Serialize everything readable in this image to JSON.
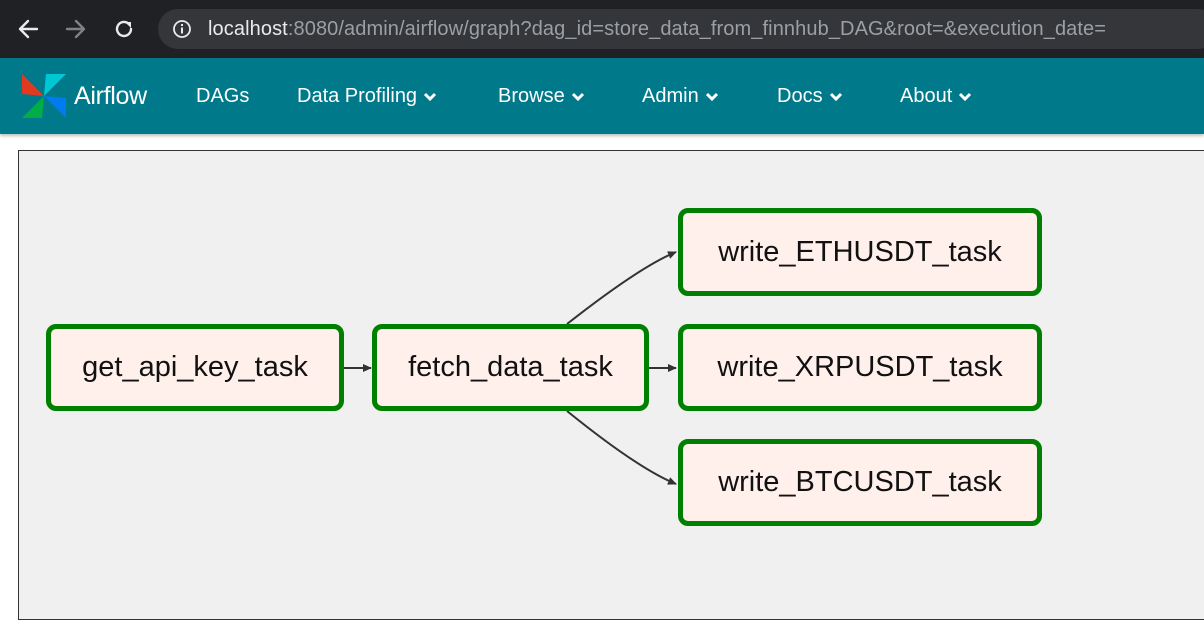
{
  "browser": {
    "url_host": "localhost",
    "url_rest": ":8080/admin/airflow/graph?dag_id=store_data_from_finnhub_DAG&root=&execution_date="
  },
  "navbar": {
    "brand": "Airflow",
    "items": [
      {
        "label": "DAGs",
        "dropdown": false
      },
      {
        "label": "Data Profiling",
        "dropdown": true
      },
      {
        "label": "Browse",
        "dropdown": true
      },
      {
        "label": "Admin",
        "dropdown": true
      },
      {
        "label": "Docs",
        "dropdown": true
      },
      {
        "label": "About",
        "dropdown": true
      }
    ]
  },
  "graph": {
    "tasks": [
      {
        "id": "get_api_key_task",
        "label": "get_api_key_task",
        "state_color": "#008000"
      },
      {
        "id": "fetch_data_task",
        "label": "fetch_data_task",
        "state_color": "#008000"
      },
      {
        "id": "write_ETHUSDT_task",
        "label": "write_ETHUSDT_task",
        "state_color": "#008000"
      },
      {
        "id": "write_XRPUSDT_task",
        "label": "write_XRPUSDT_task",
        "state_color": "#008000"
      },
      {
        "id": "write_BTCUSDT_task",
        "label": "write_BTCUSDT_task",
        "state_color": "#008000"
      }
    ],
    "edges": [
      [
        "get_api_key_task",
        "fetch_data_task"
      ],
      [
        "fetch_data_task",
        "write_ETHUSDT_task"
      ],
      [
        "fetch_data_task",
        "write_XRPUSDT_task"
      ],
      [
        "fetch_data_task",
        "write_BTCUSDT_task"
      ]
    ]
  }
}
